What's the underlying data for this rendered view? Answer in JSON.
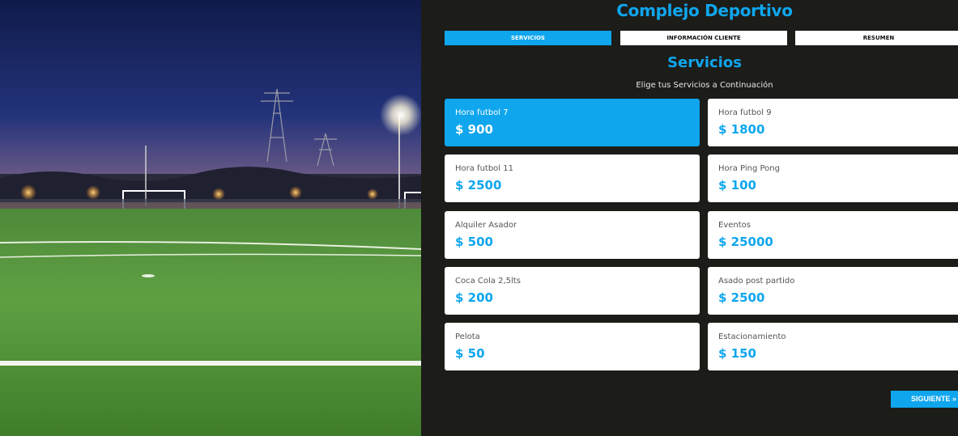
{
  "header": {
    "title": "Complejo Deportivo"
  },
  "steps": [
    {
      "label": "SERVICIOS",
      "active": true
    },
    {
      "label": "INFORMACIÓN CLIENTE",
      "active": false
    },
    {
      "label": "RESUMEN",
      "active": false
    }
  ],
  "section": {
    "title": "Servicios",
    "subtitle": "Elige tus Servicios a Continuación"
  },
  "services": [
    {
      "name": "Hora futbol 7",
      "price": "$ 900",
      "selected": true
    },
    {
      "name": "Hora futbol 9",
      "price": "$ 1800",
      "selected": false
    },
    {
      "name": "Hora futbol 11",
      "price": "$ 2500",
      "selected": false
    },
    {
      "name": "Hora Ping Pong",
      "price": "$ 100",
      "selected": false
    },
    {
      "name": "Alquiler Asador",
      "price": "$ 500",
      "selected": false
    },
    {
      "name": "Eventos",
      "price": "$ 25000",
      "selected": false
    },
    {
      "name": "Coca Cola 2,5lts",
      "price": "$ 200",
      "selected": false
    },
    {
      "name": "Asado post partido",
      "price": "$ 2500",
      "selected": false
    },
    {
      "name": "Pelota",
      "price": "$ 50",
      "selected": false
    },
    {
      "name": "Estacionamiento",
      "price": "$ 150",
      "selected": false
    }
  ],
  "footer": {
    "next_label": "SIGUIENTE »"
  },
  "colors": {
    "accent": "#0fa6ee",
    "background": "#1c1c19",
    "card": "#ffffff"
  }
}
